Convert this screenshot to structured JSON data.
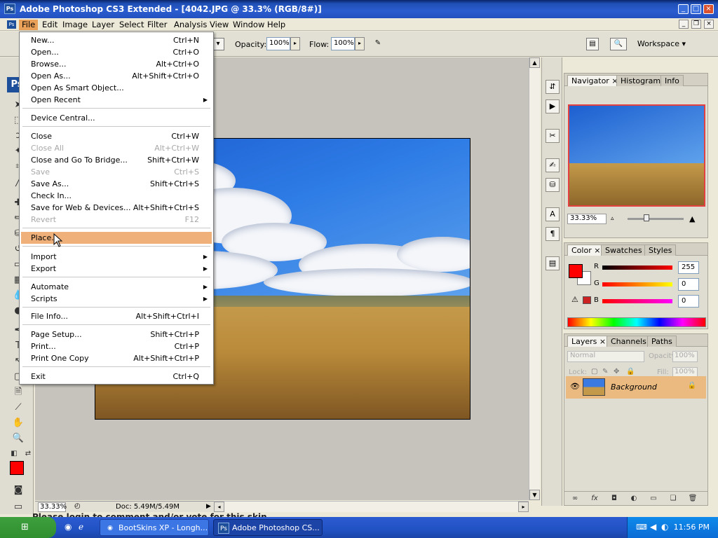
{
  "window": {
    "title": "Adobe Photoshop CS3 Extended - [4042.JPG @ 33.3% (RGB/8#)]"
  },
  "menubar": [
    "File",
    "Edit",
    "Image",
    "Layer",
    "Select",
    "Filter",
    "Analysis",
    "View",
    "Window",
    "Help"
  ],
  "options": {
    "opacity_label": "Opacity:",
    "opacity_value": "100%",
    "flow_label": "Flow:",
    "flow_value": "100%",
    "workspace_label": "Workspace"
  },
  "file_menu": {
    "items": [
      {
        "label": "New...",
        "shortcut": "Ctrl+N"
      },
      {
        "label": "Open...",
        "shortcut": "Ctrl+O"
      },
      {
        "label": "Browse...",
        "shortcut": "Alt+Ctrl+O"
      },
      {
        "label": "Open As...",
        "shortcut": "Alt+Shift+Ctrl+O"
      },
      {
        "label": "Open As Smart Object...",
        "shortcut": ""
      },
      {
        "label": "Open Recent",
        "shortcut": "",
        "submenu": true
      },
      {
        "label": "Device Central...",
        "shortcut": ""
      },
      {
        "label": "Close",
        "shortcut": "Ctrl+W"
      },
      {
        "label": "Close All",
        "shortcut": "Alt+Ctrl+W",
        "disabled": true
      },
      {
        "label": "Close and Go To Bridge...",
        "shortcut": "Shift+Ctrl+W"
      },
      {
        "label": "Save",
        "shortcut": "Ctrl+S",
        "disabled": true
      },
      {
        "label": "Save As...",
        "shortcut": "Shift+Ctrl+S"
      },
      {
        "label": "Check In...",
        "shortcut": ""
      },
      {
        "label": "Save for Web & Devices...",
        "shortcut": "Alt+Shift+Ctrl+S"
      },
      {
        "label": "Revert",
        "shortcut": "F12",
        "disabled": true
      },
      {
        "label": "Place...",
        "shortcut": "",
        "highlighted": true
      },
      {
        "label": "Import",
        "shortcut": "",
        "submenu": true
      },
      {
        "label": "Export",
        "shortcut": "",
        "submenu": true
      },
      {
        "label": "Automate",
        "shortcut": "",
        "submenu": true
      },
      {
        "label": "Scripts",
        "shortcut": "",
        "submenu": true
      },
      {
        "label": "File Info...",
        "shortcut": "Alt+Shift+Ctrl+I"
      },
      {
        "label": "Page Setup...",
        "shortcut": "Shift+Ctrl+P"
      },
      {
        "label": "Print...",
        "shortcut": "Ctrl+P"
      },
      {
        "label": "Print One Copy",
        "shortcut": "Alt+Shift+Ctrl+P"
      },
      {
        "label": "Exit",
        "shortcut": "Ctrl+Q"
      }
    ]
  },
  "status": {
    "zoom": "33.33%",
    "doc": "Doc: 5.49M/5.49M"
  },
  "navigator": {
    "tabs": [
      "Navigator",
      "Histogram",
      "Info"
    ],
    "zoom": "33.33%"
  },
  "color": {
    "tabs": [
      "Color",
      "Swatches",
      "Styles"
    ],
    "channels": [
      {
        "name": "R",
        "value": "255"
      },
      {
        "name": "G",
        "value": "0"
      },
      {
        "name": "B",
        "value": "0"
      }
    ],
    "foreground": "#ff0000",
    "background": "#ffffff",
    "alert": "#cc2222"
  },
  "layers": {
    "tabs": [
      "Layers",
      "Channels",
      "Paths"
    ],
    "blend_mode": "Normal",
    "opacity_label": "Opacity:",
    "opacity_value": "100%",
    "lock_label": "Lock:",
    "fill_label": "Fill:",
    "fill_value": "100%",
    "items": [
      {
        "name": "Background",
        "locked": true,
        "visible": true
      }
    ]
  },
  "behind_text": "Please login to comment and/or vote for this skin",
  "taskbar": {
    "items": [
      "BootSkins XP - Longh...",
      "Adobe Photoshop CS..."
    ],
    "clock": "11:56 PM"
  }
}
